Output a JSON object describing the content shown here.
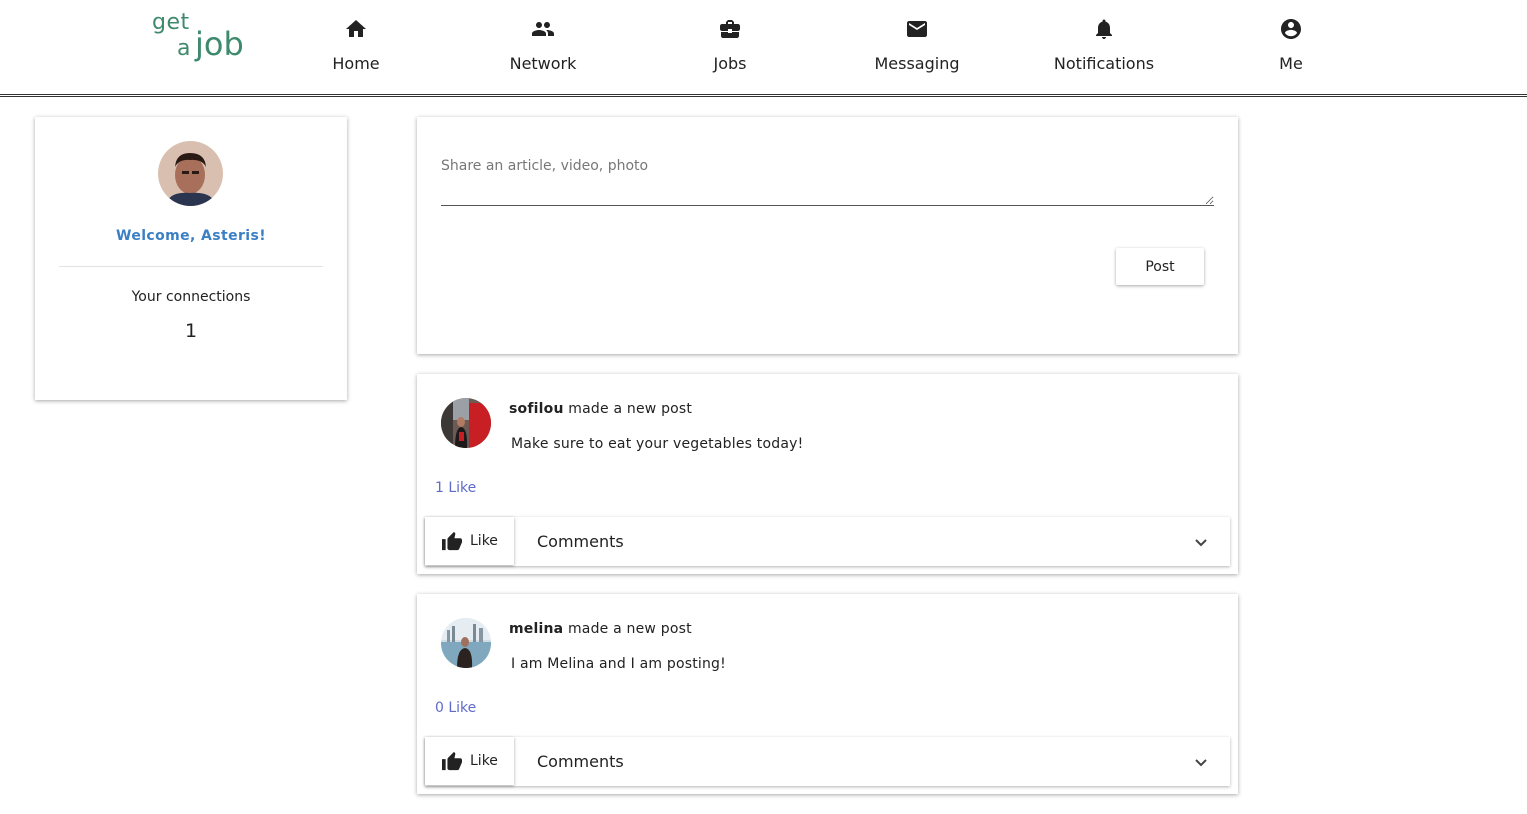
{
  "navbar": {
    "logo": {
      "line1": "get",
      "line2": "a",
      "line3": "job"
    },
    "items": [
      {
        "label": "Home",
        "icon": "home-icon"
      },
      {
        "label": "Network",
        "icon": "people-icon"
      },
      {
        "label": "Jobs",
        "icon": "briefcase-icon"
      },
      {
        "label": "Messaging",
        "icon": "mail-icon"
      },
      {
        "label": "Notifications",
        "icon": "bell-icon"
      },
      {
        "label": "Me",
        "icon": "account-circle-icon"
      }
    ]
  },
  "profile": {
    "welcome": "Welcome, Asteris!",
    "connections_label": "Your connections",
    "connections_count": "1"
  },
  "share": {
    "placeholder": "Share an article, video, photo",
    "post_label": "Post"
  },
  "posts": [
    {
      "author": "sofilou",
      "action": "made a new post",
      "body": "Make sure to eat your vegetables today!",
      "likes": "1 Like",
      "like_label": "Like",
      "comments_label": "Comments"
    },
    {
      "author": "melina",
      "action": "made a new post",
      "body": "I am Melina and I am posting!",
      "likes": "0 Like",
      "like_label": "Like",
      "comments_label": "Comments"
    }
  ],
  "colors": {
    "logo": "#3e8a6e",
    "welcome": "#3b7fc4",
    "like_count": "#5f6bc9"
  }
}
